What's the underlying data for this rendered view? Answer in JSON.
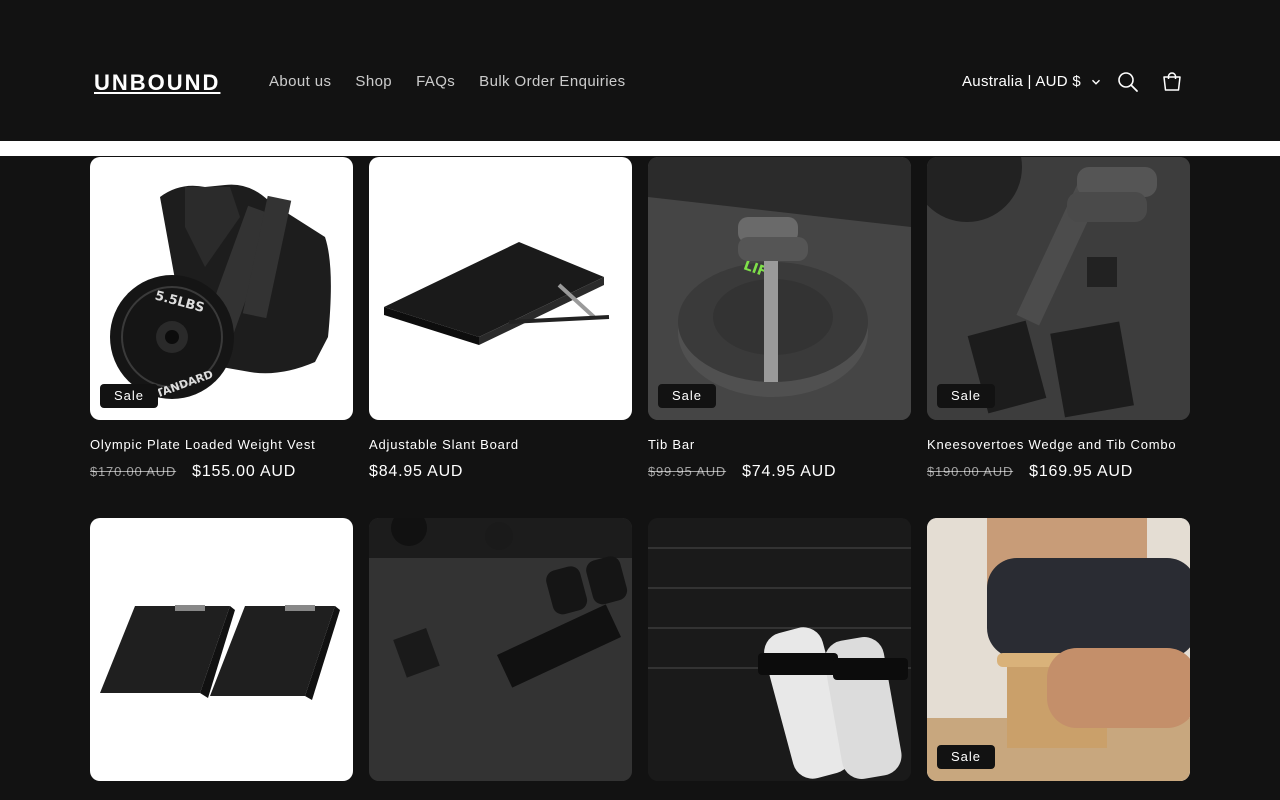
{
  "header": {
    "logo_text": "UNBOUND",
    "nav": [
      {
        "label": "About us"
      },
      {
        "label": "Shop"
      },
      {
        "label": "FAQs"
      },
      {
        "label": "Bulk Order Enquiries"
      }
    ],
    "locale": "Australia | AUD $",
    "icons": {
      "search": "search-icon",
      "cart": "cart-icon",
      "locale_chevron": "chevron-down-icon"
    }
  },
  "products": [
    {
      "title": "Olympic Plate Loaded Weight Vest",
      "compare_price": "$170.00 AUD",
      "price": "$155.00 AUD",
      "badge": "Sale"
    },
    {
      "title": "Adjustable Slant Board",
      "compare_price": "",
      "price": "$84.95 AUD",
      "badge": ""
    },
    {
      "title": "Tib Bar",
      "compare_price": "$99.95 AUD",
      "price": "$74.95 AUD",
      "badge": "Sale"
    },
    {
      "title": "Kneesovertoes Wedge and Tib Combo",
      "compare_price": "$190.00 AUD",
      "price": "$169.95 AUD",
      "badge": "Sale"
    },
    {
      "title": "",
      "compare_price": "",
      "price": "",
      "badge": ""
    },
    {
      "title": "",
      "compare_price": "",
      "price": "",
      "badge": ""
    },
    {
      "title": "",
      "compare_price": "",
      "price": "",
      "badge": ""
    },
    {
      "title": "",
      "compare_price": "",
      "price": "",
      "badge": "Sale"
    }
  ],
  "colors": {
    "background": "#121212",
    "text": "#ffffff",
    "badge_bg": "#121212"
  }
}
